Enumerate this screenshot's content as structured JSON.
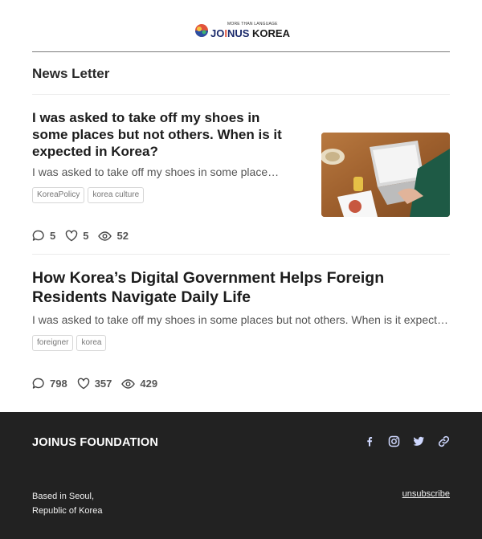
{
  "header": {
    "logo_tagline": "MORE THAN LANGUAGE",
    "logo_word_a": "JO",
    "logo_word_b": "I",
    "logo_word_c": "NUS",
    "logo_word_d": "KOREA"
  },
  "section": {
    "title": "News Letter"
  },
  "posts": [
    {
      "title": "I was asked to take off my shoes in some places but not others. When is it expected in Korea?",
      "excerpt": "I was asked to take off my shoes in some places but not others. When is it expected in Korea?",
      "tags": [
        "KoreaPolicy",
        "korea culture"
      ],
      "comments": "5",
      "likes": "5",
      "views": "52"
    },
    {
      "title": "How Korea’s Digital Government Helps Foreign Residents Navigate Daily Life",
      "excerpt": "I was asked to take off my shoes in some places but not others. When is it expected in Korea?",
      "tags": [
        "foreigner",
        "korea"
      ],
      "comments": "798",
      "likes": "357",
      "views": "429"
    }
  ],
  "footer": {
    "brand": "JOINUS FOUNDATION",
    "address_line1": "Based in Seoul,",
    "address_line2": "Republic of Korea",
    "unsubscribe": "unsubscribe",
    "social_icons": [
      "facebook-icon",
      "instagram-icon",
      "twitter-icon",
      "link-icon"
    ]
  },
  "colors": {
    "footer_bg": "#222222",
    "text_dark": "#1c1c1c",
    "text_muted": "#555555",
    "logo_navy": "#1b2a6b",
    "logo_red": "#e2533b"
  }
}
